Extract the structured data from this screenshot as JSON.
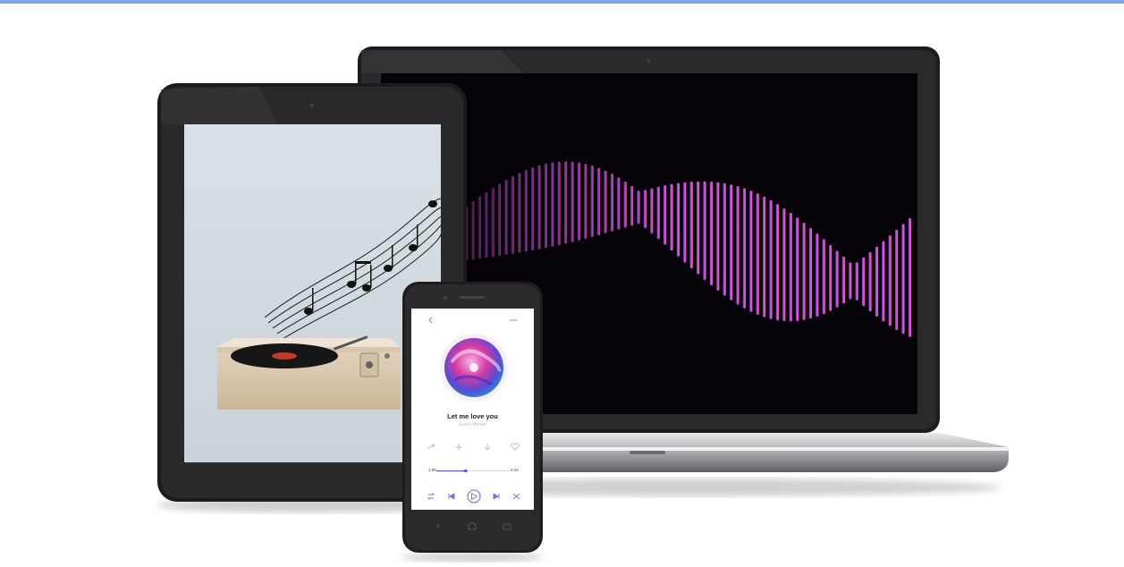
{
  "player": {
    "song_title": "Let me love you",
    "artist": "Justin Bieber",
    "time_elapsed": "1:00",
    "time_total": "4:10",
    "progress": 0.4
  },
  "icons": {
    "back": "chevron-left-icon",
    "more": "more-dots-icon",
    "share": "share-icon",
    "add": "plus-icon",
    "download": "download-icon",
    "favorite": "heart-icon",
    "repeat": "repeat-icon",
    "previous": "skip-back-icon",
    "play": "play-icon",
    "next": "skip-forward-icon",
    "shuffle": "shuffle-icon"
  },
  "colors": {
    "accent": "#6c4ce0",
    "wave_start": "#9b3cff",
    "wave_end": "#ff5a5a",
    "top_bar": "#7fa7e3"
  }
}
